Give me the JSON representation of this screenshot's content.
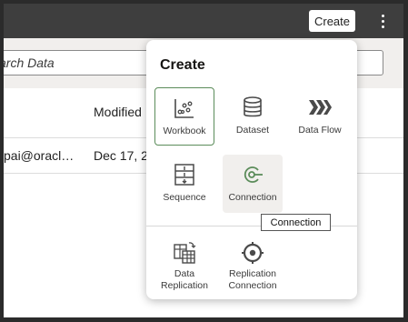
{
  "header": {
    "create_label": "Create"
  },
  "search": {
    "placeholder": "Search Data",
    "visible_text": "arch Data"
  },
  "table": {
    "columns": {
      "modified": "Modified"
    },
    "rows": [
      {
        "owner": "pai@oracl…",
        "modified": "Dec 17, 2"
      }
    ]
  },
  "popup": {
    "title": "Create",
    "items": [
      {
        "label": "Workbook",
        "icon": "workbook-icon"
      },
      {
        "label": "Dataset",
        "icon": "dataset-icon"
      },
      {
        "label": "Data Flow",
        "icon": "data-flow-icon"
      },
      {
        "label": "Sequence",
        "icon": "sequence-icon"
      },
      {
        "label": "Connection",
        "icon": "connection-icon"
      }
    ],
    "secondary_items": [
      {
        "label_line1": "Data",
        "label_line2": "Replication",
        "icon": "data-replication-icon"
      },
      {
        "label_line1": "Replication",
        "label_line2": "Connection",
        "icon": "replication-connection-icon"
      }
    ],
    "tooltip": "Connection"
  },
  "colors": {
    "topbar": "#3e3e3e",
    "accent_green": "#5b8c5a",
    "icon_gray": "#4a4a4a"
  }
}
